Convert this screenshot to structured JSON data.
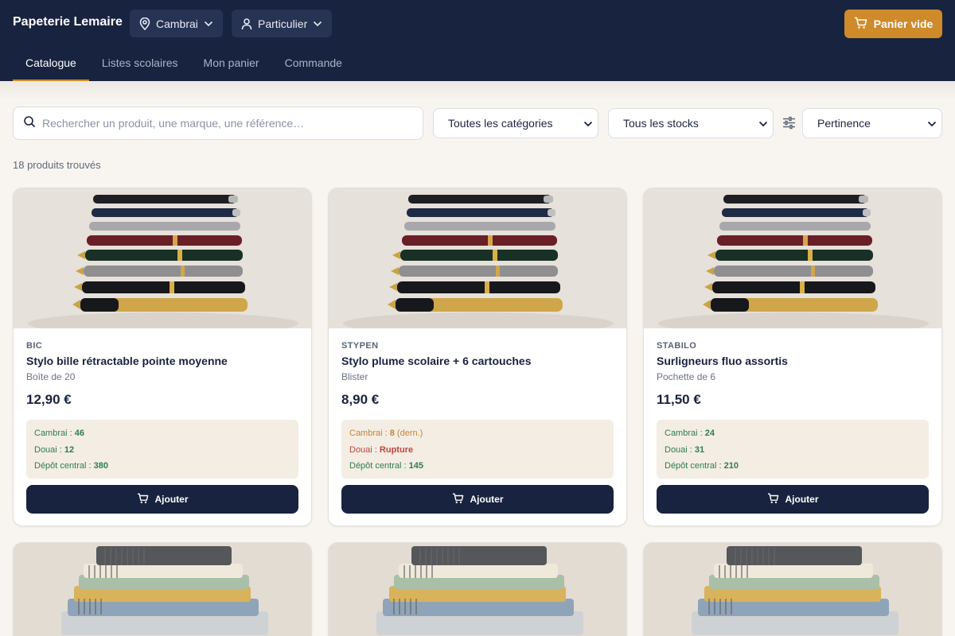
{
  "header": {
    "brand": "Papeterie Lemaire",
    "location": "Cambrai",
    "customer_type": "Particulier",
    "cart_label": "Panier vide"
  },
  "nav": {
    "tabs": [
      {
        "label": "Catalogue",
        "active": true
      },
      {
        "label": "Listes scolaires",
        "active": false
      },
      {
        "label": "Mon panier",
        "active": false
      },
      {
        "label": "Commande",
        "active": false
      }
    ]
  },
  "filters": {
    "search_placeholder": "Rechercher un produit, une marque, une référence…",
    "category": "Toutes les catégories",
    "stock": "Tous les stocks",
    "sort": "Pertinence"
  },
  "results_count": "18 produits trouvés",
  "products": [
    {
      "brand": "BIC",
      "name": "Stylo bille rétractable pointe moyenne",
      "pack": "Boîte de 20",
      "price": "12,90 €",
      "stock": [
        {
          "label": "Cambrai : ",
          "value": "46",
          "suffix": "",
          "status": "ok"
        },
        {
          "label": "Douai : ",
          "value": "12",
          "suffix": "",
          "status": "ok"
        },
        {
          "label": "Dépôt central : ",
          "value": "380",
          "suffix": "",
          "status": "ok"
        }
      ],
      "add_label": "Ajouter"
    },
    {
      "brand": "STYPEN",
      "name": "Stylo plume scolaire + 6 cartouches",
      "pack": "Blister",
      "price": "8,90 €",
      "stock": [
        {
          "label": "Cambrai : ",
          "value": "8",
          "suffix": " (dern.)",
          "status": "low"
        },
        {
          "label": "Douai : ",
          "value": "Rupture",
          "suffix": "",
          "status": "out"
        },
        {
          "label": "Dépôt central : ",
          "value": "145",
          "suffix": "",
          "status": "ok"
        }
      ],
      "add_label": "Ajouter"
    },
    {
      "brand": "STABILO",
      "name": "Surligneurs fluo assortis",
      "pack": "Pochette de 6",
      "price": "11,50 €",
      "stock": [
        {
          "label": "Cambrai : ",
          "value": "24",
          "suffix": "",
          "status": "ok"
        },
        {
          "label": "Douai : ",
          "value": "31",
          "suffix": "",
          "status": "ok"
        },
        {
          "label": "Dépôt central : ",
          "value": "210",
          "suffix": "",
          "status": "ok"
        }
      ],
      "add_label": "Ajouter"
    }
  ],
  "colors": {
    "header_bg": "#18233f",
    "accent": "#cf8a2a",
    "stock_ok": "#2f7d4e",
    "stock_low": "#c88534",
    "stock_out": "#c0463c"
  }
}
